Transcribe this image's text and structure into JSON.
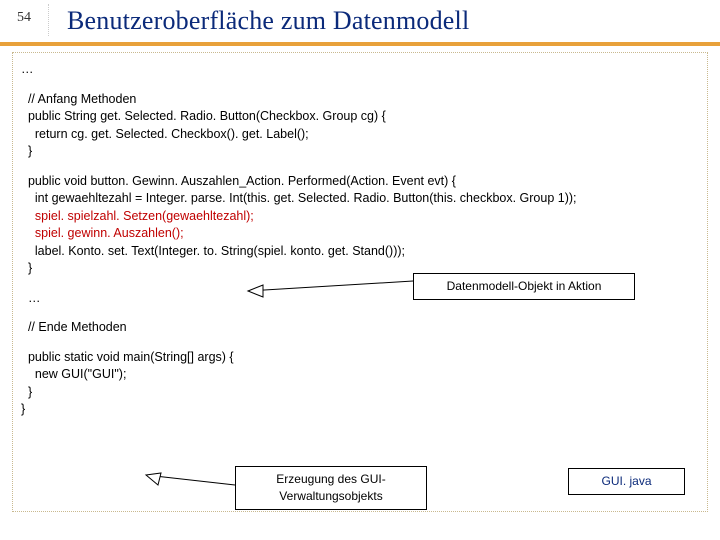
{
  "page_number": "54",
  "title": "Benutzeroberfläche zum Datenmodell",
  "ellipsis": "…",
  "code": {
    "comment_begin": "  // Anfang Methoden",
    "m1_sig": "  public String get. Selected. Radio. Button(Checkbox. Group cg) {",
    "m1_body": "    return cg. get. Selected. Checkbox(). get. Label();",
    "m1_close": "  }",
    "m2_sig": "  public void button. Gewinn. Auszahlen_Action. Performed(Action. Event evt) {",
    "m2_l1": "    int gewaehltezahl = Integer. parse. Int(this. get. Selected. Radio. Button(this. checkbox. Group 1));",
    "m2_l2": "    spiel. spielzahl. Setzen(gewaehltezahl);",
    "m2_l3": "    spiel. gewinn. Auszahlen();",
    "m2_l4": "    label. Konto. set. Text(Integer. to. String(spiel. konto. get. Stand()));",
    "m2_close": "  }",
    "ellipsis2": "  …",
    "comment_end": "  // Ende Methoden",
    "main_sig": "  public static void main(String[] args) {",
    "main_body": "    new GUI(\"GUI\");",
    "main_close": "  }",
    "class_close": "}"
  },
  "callouts": {
    "model": "Datenmodell-Objekt in Aktion",
    "gui_create": "Erzeugung des GUI-Verwaltungsobjekts",
    "gui_file": "GUI. java"
  }
}
